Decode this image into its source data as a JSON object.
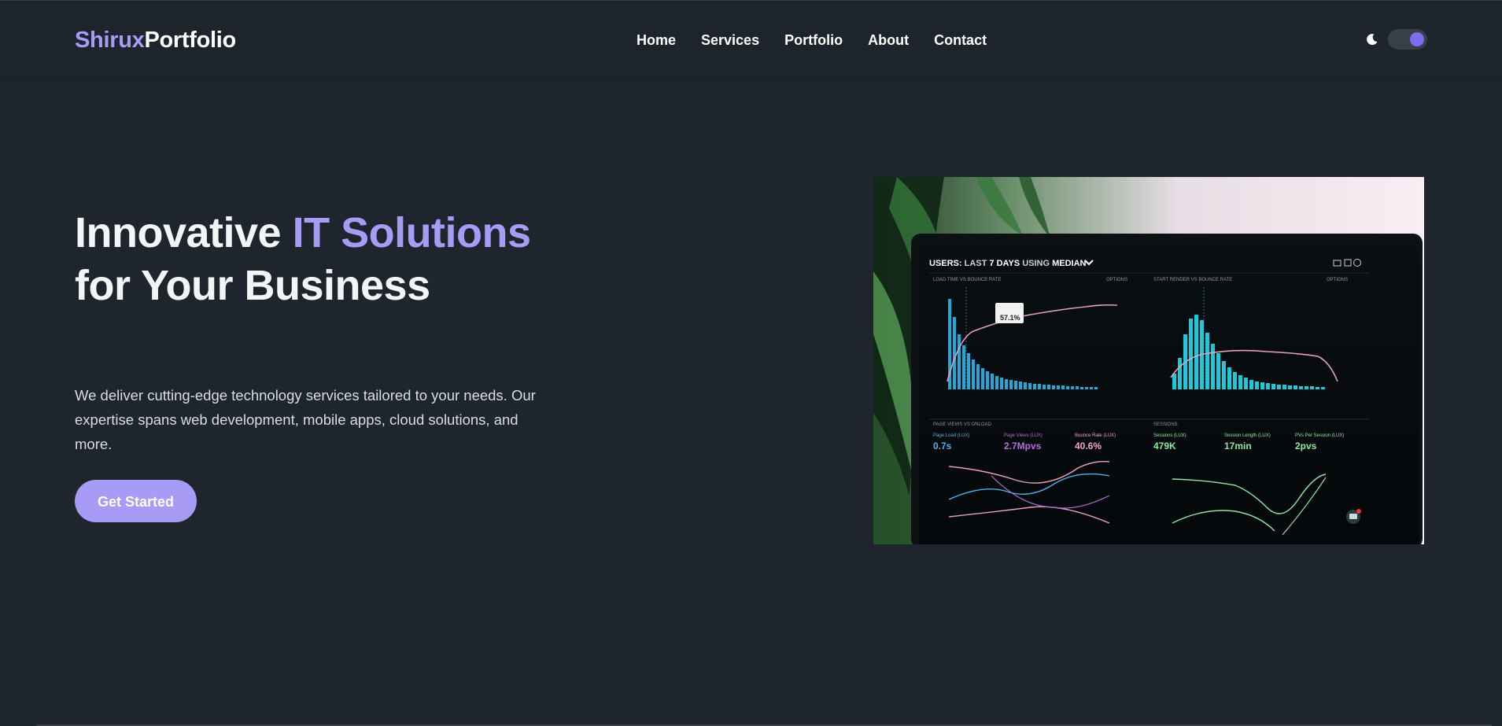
{
  "brand": {
    "accent": "Shirux",
    "rest": "Portfolio"
  },
  "nav": {
    "links": [
      "Home",
      "Services",
      "Portfolio",
      "About",
      "Contact"
    ]
  },
  "theme_toggle": {
    "icon": "moon-icon",
    "state": "dark"
  },
  "hero": {
    "title_part1": "Innovative ",
    "title_accent": "IT Solutions",
    "title_part2": " for Your Business",
    "description": "We deliver cutting-edge technology services tailored to your needs. Our expertise spans web development, mobile apps, cloud solutions, and more.",
    "cta_label": "Get Started"
  },
  "dashboard_image": {
    "header_prefix": "USERS: ",
    "header_mid": "LAST ",
    "header_bold": "7 DAYS",
    "header_using": " USING ",
    "header_median": "MEDIAN",
    "panel1_title": "LOAD TIME VS BOUNCE RATE",
    "panel2_title": "START RENDER VS BOUNCE RATE",
    "panel3_title": "PAGE VIEWS VS ONLOAD",
    "panel4_title": "SESSIONS",
    "options_label": "OPTIONS",
    "tooltip_value": "57.1%",
    "metrics": [
      {
        "label": "Page Load (LUX)",
        "value": "0.7s"
      },
      {
        "label": "Page Views (LUX)",
        "value": "2.7Mpvs"
      },
      {
        "label": "Bounce Rate (LUX)",
        "value": "40.6%"
      },
      {
        "label": "Sessions (LUX)",
        "value": "479K"
      },
      {
        "label": "Session Length (LUX)",
        "value": "17min"
      },
      {
        "label": "PVs Per Session (LUX)",
        "value": "2pvs"
      }
    ],
    "colors": {
      "accent": "#a89bf5",
      "bars_blue": "#1fa8d8",
      "bars_cyan": "#1fc8d8",
      "line_pink": "#e6a0bd",
      "metric_blue": "#4ab3ea",
      "metric_purple": "#b56fd6",
      "metric_pink": "#f2a4c7",
      "metric_green": "#8ee6a6"
    }
  }
}
